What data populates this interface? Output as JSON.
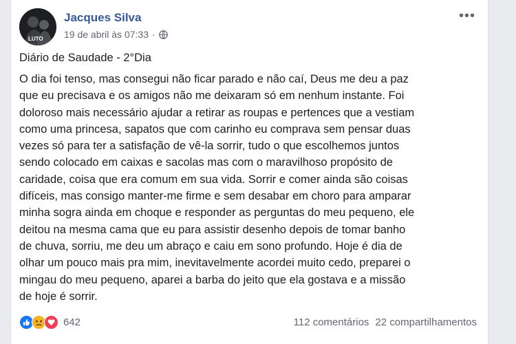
{
  "post": {
    "author": "Jacques Silva",
    "timestamp": "19 de abril às 07:33",
    "dot": "·",
    "privacy_icon": "globe-icon",
    "more_icon": "more-options-icon",
    "avatar_badge": "LUTO",
    "title": "Diário de Saudade - 2°Dia",
    "body_lines": [
      "O dia foi tenso, mas consegui não ficar parado e não caí, Deus me deu a paz",
      "que eu precisava e os amigos não me deixaram só em nenhum instante. Foi",
      "doloroso mais necessário ajudar a retirar as roupas e pertences que a vestiam",
      "como uma princesa, sapatos que com carinho eu comprava sem pensar duas",
      "vezes só para ter a satisfação de vê-la sorrir, tudo o que escolhemos juntos",
      "sendo colocado em caixas e sacolas mas com o maravilhoso propósito de",
      "caridade, coisa que era comum em sua vida. Sorrir e comer ainda são coisas",
      "difíceis, mas consigo manter-me firme e sem desabar em choro para amparar",
      "minha sogra ainda em choque e responder as perguntas do meu pequeno, ele",
      "deitou na mesma cama que eu para assistir desenho depois de tomar banho",
      "de chuva, sorriu, me deu um abraço e caiu em sono profundo. Hoje é dia de",
      "olhar um pouco mais pra mim, inevitavelmente acordei muito cedo, preparei o",
      "mingau do meu pequeno, aparei a barba do jeito que ela gostava e a missão",
      "de hoje é sorrir."
    ]
  },
  "footer": {
    "reactions": [
      "like-icon",
      "sad-icon",
      "love-icon"
    ],
    "reaction_count": "642",
    "comments": "112 comentários",
    "shares": "22 compartilhamentos"
  },
  "colors": {
    "author": "#385898",
    "text": "#1c1e21",
    "meta": "#616770",
    "like": "#1877f2",
    "sad": "#f7b125",
    "love": "#f33e58"
  }
}
